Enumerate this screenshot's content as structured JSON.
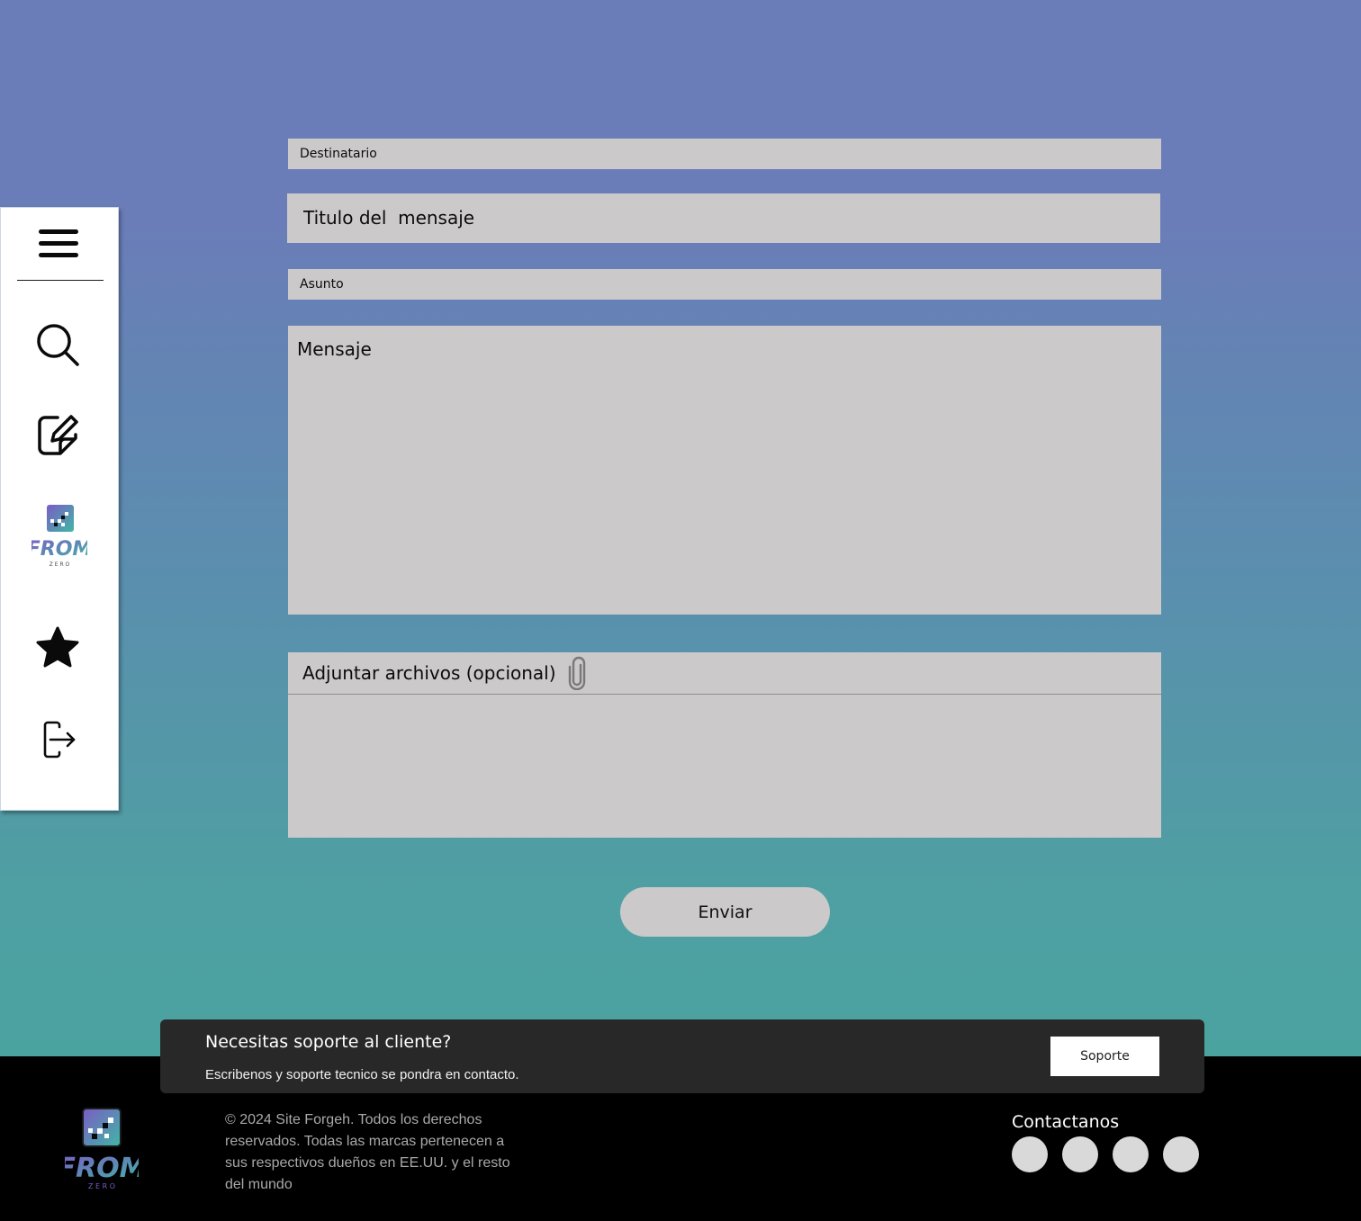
{
  "sidebar": {
    "items": [
      {
        "icon": "menu-icon"
      },
      {
        "icon": "search-icon"
      },
      {
        "icon": "edit-icon"
      },
      {
        "icon": "from-zero-logo"
      },
      {
        "icon": "star-icon"
      },
      {
        "icon": "logout-icon"
      }
    ]
  },
  "brand": {
    "word": "FROM",
    "sub": "Z E R O"
  },
  "form": {
    "recipient_placeholder": "Destinatario",
    "title_placeholder": "Titulo del  mensaje",
    "subject_placeholder": "Asunto",
    "message_placeholder": "Mensaje",
    "attach_label": "Adjuntar archivos (opcional)",
    "send_label": "Enviar"
  },
  "footer": {
    "support_title": "Necesitas soporte al cliente?",
    "support_text": "Escribenos y soporte tecnico se pondra en contacto.",
    "support_button": "Soporte",
    "copyright": "© 2024 Site Forgeh. Todos los derechos reservados. Todas las marcas pertenecen a sus respectivos dueños en EE.UU. y el resto del mundo",
    "contact_title": "Contactanos",
    "social_count": 4
  },
  "colors": {
    "background_top": "#6a7db8",
    "background_bottom": "#4ba3a0",
    "field_bg": "#cbc9ca",
    "footer_bg": "#000000",
    "support_card_bg": "#282828",
    "logo_purple": "#7b5cc4",
    "logo_teal": "#3fb7a6"
  }
}
